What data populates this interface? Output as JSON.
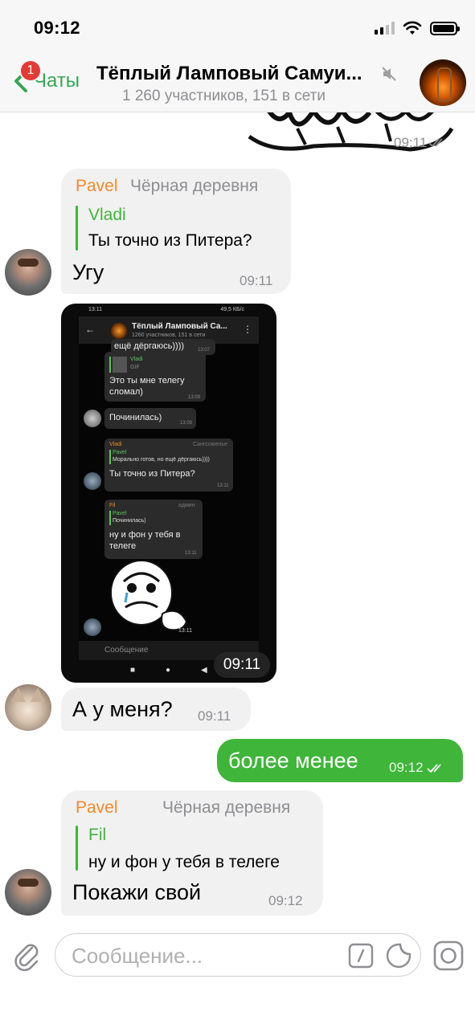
{
  "status_bar": {
    "time": "09:12",
    "icons": [
      "signal-icon",
      "wifi-icon",
      "battery-icon"
    ]
  },
  "header": {
    "back_label": "Чаты",
    "unread_badge": "1",
    "title": "Тёплый Ламповый Самуи...",
    "subtitle": "1 260 участников, 151 в сети",
    "muted": true,
    "accent_color": "#34a853"
  },
  "messages": {
    "sticker_top": {
      "time": "09:11"
    },
    "msg1": {
      "sender": "Pavel",
      "sender_title": "Чёрная деревня",
      "reply_name": "Vladi",
      "reply_text": "Ты точно из Питера?",
      "text": "Угу",
      "time": "09:11"
    },
    "screenshot": {
      "time": "09:11",
      "status_left": "13:11",
      "status_right": "49,5 КБ/с",
      "title": "Тёплый Ламповый Са...",
      "subtitle": "1260 участников, 151 в сети",
      "top_fragment": "ещё дёргаюсь))))",
      "top_fragment_time": "13:07",
      "b1_name": "Vladi",
      "b1_reply": "GIF",
      "b1_text1": "Это ты мне телегу",
      "b1_text2": "сломал)",
      "b1_time": "13:09",
      "b2_text": "Починилась)",
      "b2_time": "13:09",
      "b3_name": "Vladi",
      "b3_title": "Сангсомелье",
      "b3_reply_name": "Pavel",
      "b3_reply_text": "Морально готов, но ещё дёргаюсь))))",
      "b3_text": "Ты точно из Питера?",
      "b3_time": "13:11",
      "b4_name": "Fil",
      "b4_title": "админ",
      "b4_reply_name": "Pavel",
      "b4_reply_text": "Починилась)",
      "b4_text1": "ну и фон у тебя в",
      "b4_text2": "телеге",
      "b4_time": "13:11",
      "sticker_time": "13:11",
      "input_placeholder": "Сообщение"
    },
    "msg2": {
      "text": "А у меня?",
      "time": "09:11"
    },
    "msg3": {
      "text": "более менее",
      "time": "09:12",
      "status": "read"
    },
    "msg4": {
      "sender": "Pavel",
      "sender_title": "Чёрная деревня",
      "reply_name": "Fil",
      "reply_text": "ну и фон у тебя в телеге",
      "text": "Покажи свой",
      "time": "09:12"
    }
  },
  "input": {
    "placeholder": "Сообщение..."
  },
  "colors": {
    "outgoing_bubble": "#3fb53a",
    "incoming_bubble": "#f1f1f1",
    "sender_name": "#ef8a2c",
    "reply_name": "#3fb53a"
  }
}
